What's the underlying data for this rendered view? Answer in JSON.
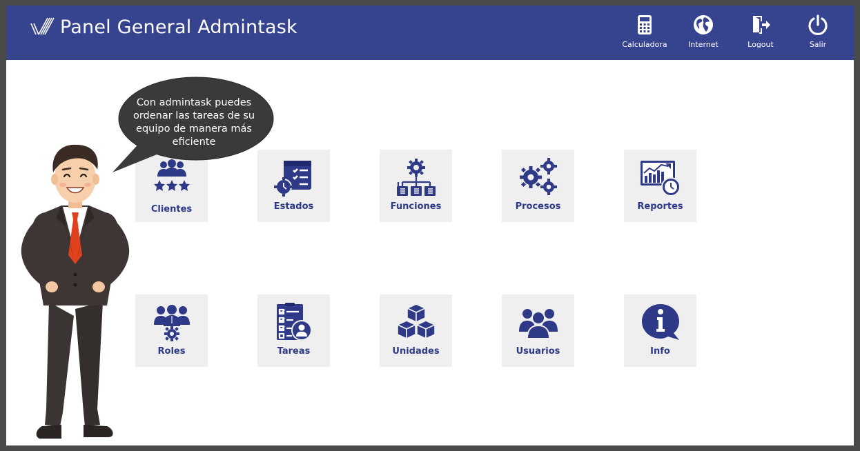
{
  "header": {
    "title": "Panel General Admintask",
    "actions": [
      {
        "label": "Calculadora",
        "icon": "calculator-icon"
      },
      {
        "label": "Internet",
        "icon": "globe-icon"
      },
      {
        "label": "Logout",
        "icon": "logout-icon"
      },
      {
        "label": "Salir",
        "icon": "power-icon"
      }
    ]
  },
  "assistant": {
    "message_lines": [
      "Con admintask puedes",
      "ordenar las tareas de su",
      "equipo de manera más",
      "eficiente"
    ]
  },
  "tiles": [
    {
      "label": "Clientes",
      "icon": "clients-icon"
    },
    {
      "label": "Estados",
      "icon": "status-icon"
    },
    {
      "label": "Funciones",
      "icon": "functions-icon"
    },
    {
      "label": "Procesos",
      "icon": "processes-icon"
    },
    {
      "label": "Reportes",
      "icon": "reports-icon"
    },
    {
      "label": "Roles",
      "icon": "roles-icon"
    },
    {
      "label": "Tareas",
      "icon": "tasks-icon"
    },
    {
      "label": "Unidades",
      "icon": "units-icon"
    },
    {
      "label": "Usuarios",
      "icon": "users-icon"
    },
    {
      "label": "Info",
      "icon": "info-icon"
    }
  ],
  "colors": {
    "header_bg": "#36438f",
    "tile_bg": "#efefef",
    "icon_color": "#2e3a87",
    "frame_bg": "#4a4a4a",
    "bubble_bg": "#3a3a3a"
  }
}
